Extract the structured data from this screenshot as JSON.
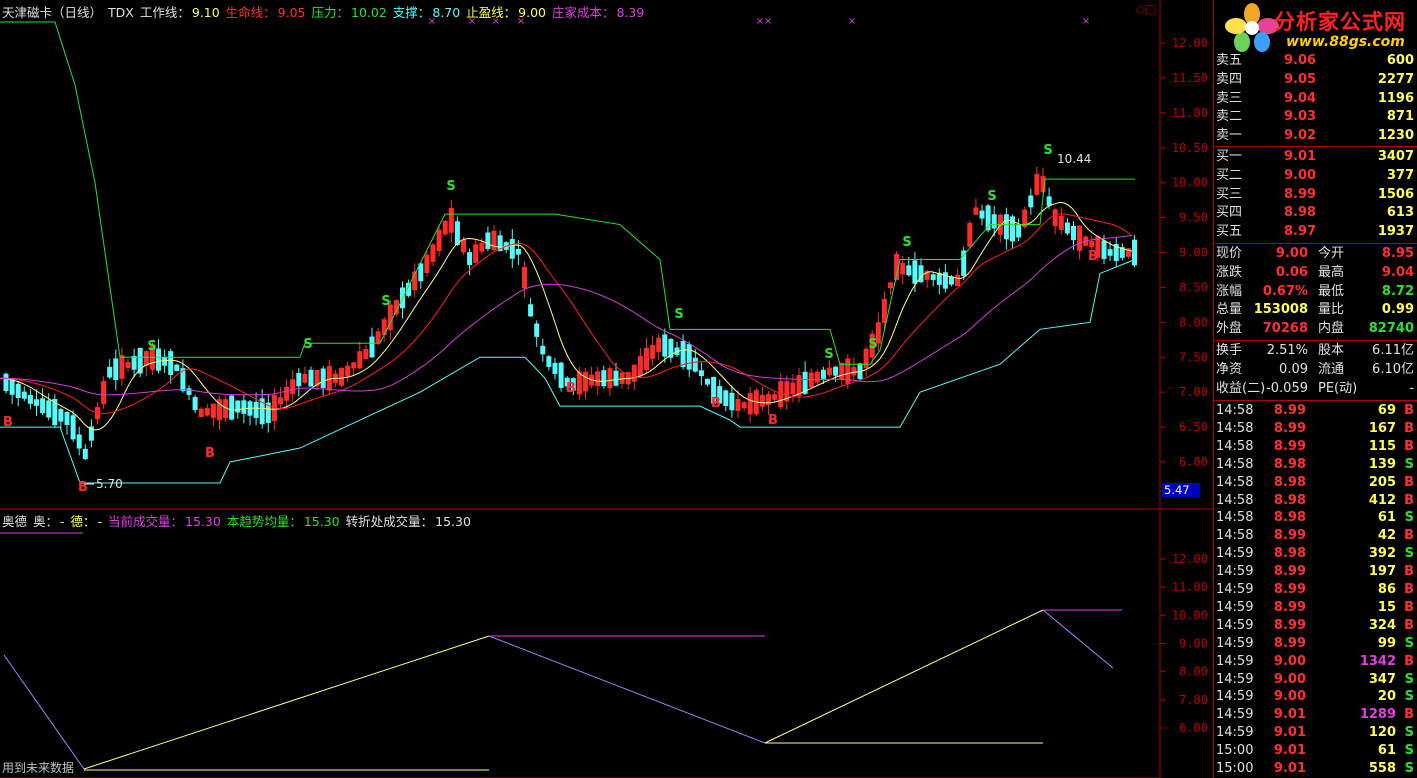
{
  "header": {
    "stock_title": "天津磁卡（日线）",
    "indicator": "TDX",
    "work_line_label": "工作线：",
    "work_line": "9.10",
    "life_line_label": "生命线：",
    "life_line": "9.05",
    "pressure_label": "压力：",
    "pressure": "10.02",
    "support_label": "支撑：",
    "support": "8.70",
    "stop_label": "止盈线：",
    "stop": "9.00",
    "cost_label": "庄家成本：",
    "cost": "8.39"
  },
  "sub_header": {
    "name": "奥德",
    "ao_label": "奥：",
    "ao": "-",
    "de_label": "德：",
    "de": "-",
    "cur_vol_label": "当前成交量：",
    "cur_vol": "15.30",
    "trend_avg_label": "本趋势均量：",
    "trend_avg": "15.30",
    "turn_vol_label": "转折处成交量：",
    "turn_vol": "15.30"
  },
  "footer_text": "用到未来数据",
  "main_axis": [
    "12.00",
    "11.50",
    "11.00",
    "10.50",
    "10.00",
    "9.50",
    "9.00",
    "8.50",
    "8.00",
    "7.50",
    "7.00",
    "6.50",
    "6.00"
  ],
  "sub_axis": [
    "12.00",
    "11.00",
    "10.00",
    "9.00",
    "8.00",
    "7.00",
    "6.00"
  ],
  "price_tag": "5.47",
  "low_marker": "5.70",
  "high_marker": "10.44",
  "colors": {
    "up": "#ff2a2a",
    "down": "#54fcfc",
    "accent_green": "#2de02d",
    "yellow": "#ffff54",
    "magenta": "#e040e0"
  },
  "logo": {
    "title": "分析家公式网",
    "url": "www.88gs.com"
  },
  "order_book": {
    "asks": [
      {
        "label": "卖五",
        "price": "9.06",
        "vol": "600"
      },
      {
        "label": "卖四",
        "price": "9.05",
        "vol": "2277"
      },
      {
        "label": "卖三",
        "price": "9.04",
        "vol": "1196"
      },
      {
        "label": "卖二",
        "price": "9.03",
        "vol": "871"
      },
      {
        "label": "卖一",
        "price": "9.02",
        "vol": "1230"
      }
    ],
    "bids": [
      {
        "label": "买一",
        "price": "9.01",
        "vol": "3407"
      },
      {
        "label": "买二",
        "price": "9.00",
        "vol": "377"
      },
      {
        "label": "买三",
        "price": "8.99",
        "vol": "1506"
      },
      {
        "label": "买四",
        "price": "8.98",
        "vol": "613"
      },
      {
        "label": "买五",
        "price": "8.97",
        "vol": "1937"
      }
    ]
  },
  "quote": [
    {
      "l1": "现价",
      "v1": "9.00",
      "l2": "今开",
      "v2": "8.95"
    },
    {
      "l1": "涨跌",
      "v1": "0.06",
      "l2": "最高",
      "v2": "9.04"
    },
    {
      "l1": "涨幅",
      "v1": "0.67%",
      "l2": "最低",
      "v2": "8.72"
    },
    {
      "l1": "总量",
      "v1": "153008",
      "l2": "量比",
      "v2": "0.99"
    },
    {
      "l1": "外盘",
      "v1": "70268",
      "l2": "内盘",
      "v2": "82740"
    }
  ],
  "fundamentals": [
    {
      "l1": "换手",
      "v1": "2.51%",
      "l2": "股本",
      "v2": "6.11亿"
    },
    {
      "l1": "净资",
      "v1": "0.09",
      "l2": "流通",
      "v2": "6.10亿"
    },
    {
      "l1": "收益(二)",
      "v1": "-0.059",
      "l2": "PE(动)",
      "v2": "-"
    }
  ],
  "ticks": [
    {
      "time": "14:58",
      "price": "8.99",
      "vol": "69",
      "side": "B"
    },
    {
      "time": "14:58",
      "price": "8.99",
      "vol": "167",
      "side": "B"
    },
    {
      "time": "14:58",
      "price": "8.99",
      "vol": "115",
      "side": "B"
    },
    {
      "time": "14:58",
      "price": "8.98",
      "vol": "139",
      "side": "S"
    },
    {
      "time": "14:58",
      "price": "8.98",
      "vol": "205",
      "side": "B"
    },
    {
      "time": "14:58",
      "price": "8.98",
      "vol": "412",
      "side": "B"
    },
    {
      "time": "14:58",
      "price": "8.98",
      "vol": "61",
      "side": "S"
    },
    {
      "time": "14:58",
      "price": "8.99",
      "vol": "42",
      "side": "B"
    },
    {
      "time": "14:59",
      "price": "8.98",
      "vol": "392",
      "side": "S"
    },
    {
      "time": "14:59",
      "price": "8.99",
      "vol": "197",
      "side": "B"
    },
    {
      "time": "14:59",
      "price": "8.99",
      "vol": "86",
      "side": "B"
    },
    {
      "time": "14:59",
      "price": "8.99",
      "vol": "15",
      "side": "B"
    },
    {
      "time": "14:59",
      "price": "8.99",
      "vol": "324",
      "side": "B"
    },
    {
      "time": "14:59",
      "price": "8.99",
      "vol": "99",
      "side": "S"
    },
    {
      "time": "14:59",
      "price": "9.00",
      "vol": "1342",
      "side": "B"
    },
    {
      "time": "14:59",
      "price": "9.00",
      "vol": "347",
      "side": "S"
    },
    {
      "time": "14:59",
      "price": "9.00",
      "vol": "20",
      "side": "S"
    },
    {
      "time": "14:59",
      "price": "9.01",
      "vol": "1289",
      "side": "B"
    },
    {
      "time": "14:59",
      "price": "9.01",
      "vol": "120",
      "side": "S"
    },
    {
      "time": "15:00",
      "price": "9.01",
      "vol": "61",
      "side": "S"
    },
    {
      "time": "15:00",
      "price": "9.01",
      "vol": "558",
      "side": "S"
    }
  ]
}
